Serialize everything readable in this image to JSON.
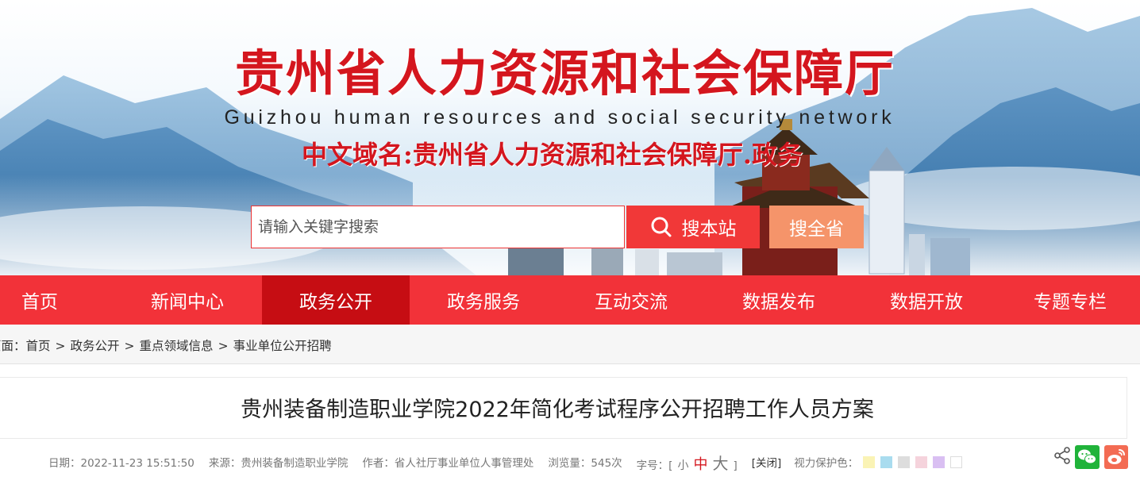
{
  "banner": {
    "title": "贵州省人力资源和社会保障厅",
    "subtitle": "Guizhou human resources and social security network",
    "domain": "中文域名:贵州省人力资源和社会保障厅.政务"
  },
  "search": {
    "placeholder": "请输入关键字搜索",
    "site_button": "搜本站",
    "province_button": "搜全省"
  },
  "nav": {
    "items": [
      {
        "label": "首页"
      },
      {
        "label": "新闻中心"
      },
      {
        "label": "政务公开",
        "active": true
      },
      {
        "label": "政务服务"
      },
      {
        "label": "互动交流"
      },
      {
        "label": "数据发布"
      },
      {
        "label": "数据开放"
      },
      {
        "label": "专题专栏"
      }
    ]
  },
  "breadcrumb": {
    "prefix": "页面：",
    "items": [
      "首页",
      "政务公开",
      "重点领域信息",
      "事业单位公开招聘"
    ],
    "separator": ">"
  },
  "article": {
    "title": "贵州装备制造职业学院2022年简化考试程序公开招聘工作人员方案",
    "meta": {
      "date": "日期：2022-11-23 15:51:50",
      "source": "来源：贵州装备制造职业学院",
      "author": "作者：省人社厅事业单位人事管理处",
      "views": "浏览量：545次",
      "font_size_label": "字号：[",
      "font_small": "小",
      "font_medium": "中",
      "font_large": "大",
      "font_close": "]",
      "close": "[关闭]",
      "eye_care_label": "视力保护色："
    },
    "eye_care_colors": [
      "#faf3b5",
      "#a9dcef",
      "#dddddd",
      "#f5d3dc",
      "#d9bff2",
      "#ffffff"
    ]
  },
  "share": {
    "icons": [
      "share-icon",
      "wechat-icon",
      "weibo-icon"
    ]
  },
  "colors": {
    "brand_red": "#f23239",
    "active_red": "#c60d13",
    "title_red": "#d4161e",
    "search_orange": "#f5946a"
  }
}
